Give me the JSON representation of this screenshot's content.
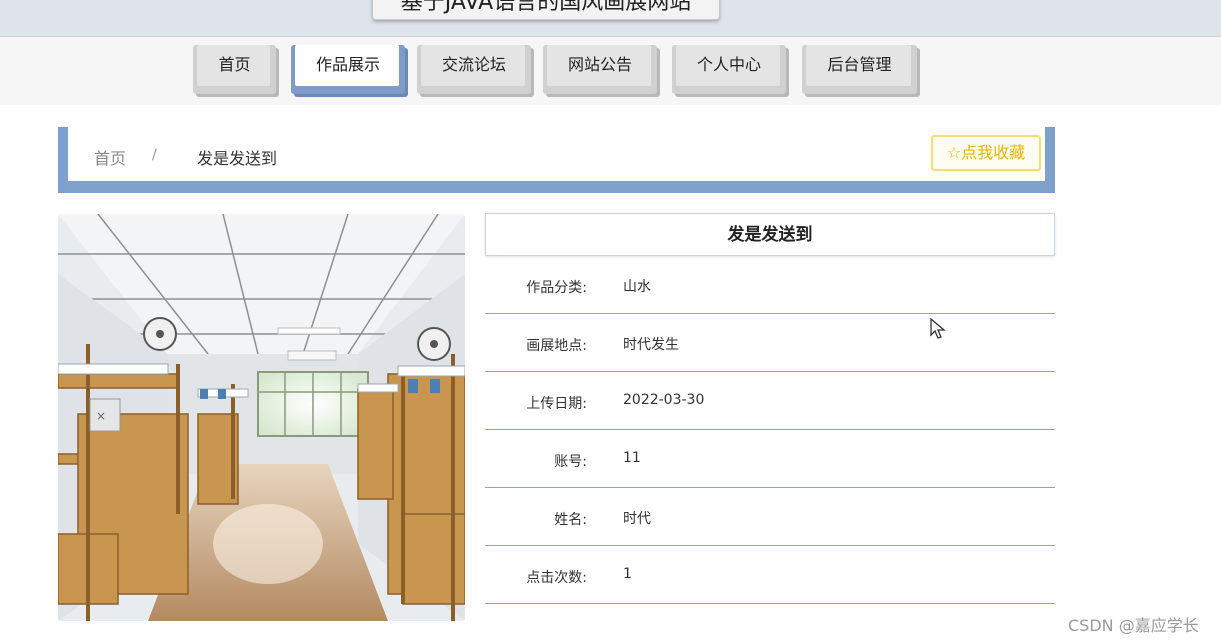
{
  "header": {
    "site_title": "基于JAVA语言的国风画展网站"
  },
  "nav": {
    "items": [
      {
        "label": "首页"
      },
      {
        "label": "作品展示"
      },
      {
        "label": "交流论坛"
      },
      {
        "label": "网站公告"
      },
      {
        "label": "个人中心"
      },
      {
        "label": "后台管理"
      }
    ],
    "active_label": "作品展示"
  },
  "breadcrumb": {
    "home": "首页",
    "separator": "/",
    "current": "发是发送到"
  },
  "favorite_button": {
    "icon": "star-outline-icon",
    "label": "点我收藏",
    "color": "#e8b500"
  },
  "artwork": {
    "image_description_icon": "photo-dormitory-room",
    "title": "发是发送到",
    "fields": [
      {
        "label": "作品分类:",
        "value": "山水"
      },
      {
        "label": "画展地点:",
        "value": "时代发生"
      },
      {
        "label": "上传日期:",
        "value": "2022-03-30"
      },
      {
        "label": "账号:",
        "value": "11"
      },
      {
        "label": "姓名:",
        "value": "时代"
      },
      {
        "label": "点击次数:",
        "value": "1"
      }
    ]
  },
  "colors": {
    "accent": "#80a0cc",
    "nav_inactive": "#d0d0d0",
    "row_divider": "#8fa2c8"
  },
  "watermark": "CSDN @嘉应学长"
}
